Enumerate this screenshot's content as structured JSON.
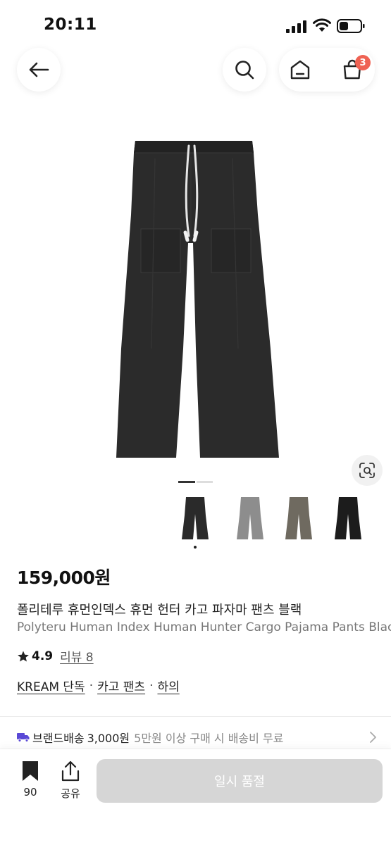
{
  "status_bar": {
    "time": "20:11"
  },
  "nav": {
    "cart_count": "3"
  },
  "gallery": {
    "thumbnail_colors": [
      "#2a2a2a",
      "#8d8d8d",
      "#6f6a60",
      "#1c1c1c"
    ],
    "selected_thumbnail": 0
  },
  "product": {
    "price": "159,000원",
    "title_ko": "폴리테루 휴먼인덱스 휴먼 헌터 카고 파자마 팬츠 블랙",
    "title_en": "Polyteru Human Index Human Hunter Cargo Pajama Pants Black",
    "rating": "4.9",
    "review_label": "리뷰 8"
  },
  "tags": [
    {
      "label": "KREAM 단독"
    },
    {
      "label": "카고 팬츠"
    },
    {
      "label": "하의"
    }
  ],
  "tag_separator": "·",
  "shipping": {
    "label": "브랜드배송",
    "fee": "3,000원",
    "note": "5만원 이상 구매 시 배송비 무료"
  },
  "bottom_bar": {
    "bookmark_count": "90",
    "share_label": "공유",
    "soldout_label": "일시 품절"
  },
  "colors": {
    "badge": "#ef6253",
    "shipping_icon": "#5a49d6",
    "disabled_button": "#d6d6d6"
  }
}
